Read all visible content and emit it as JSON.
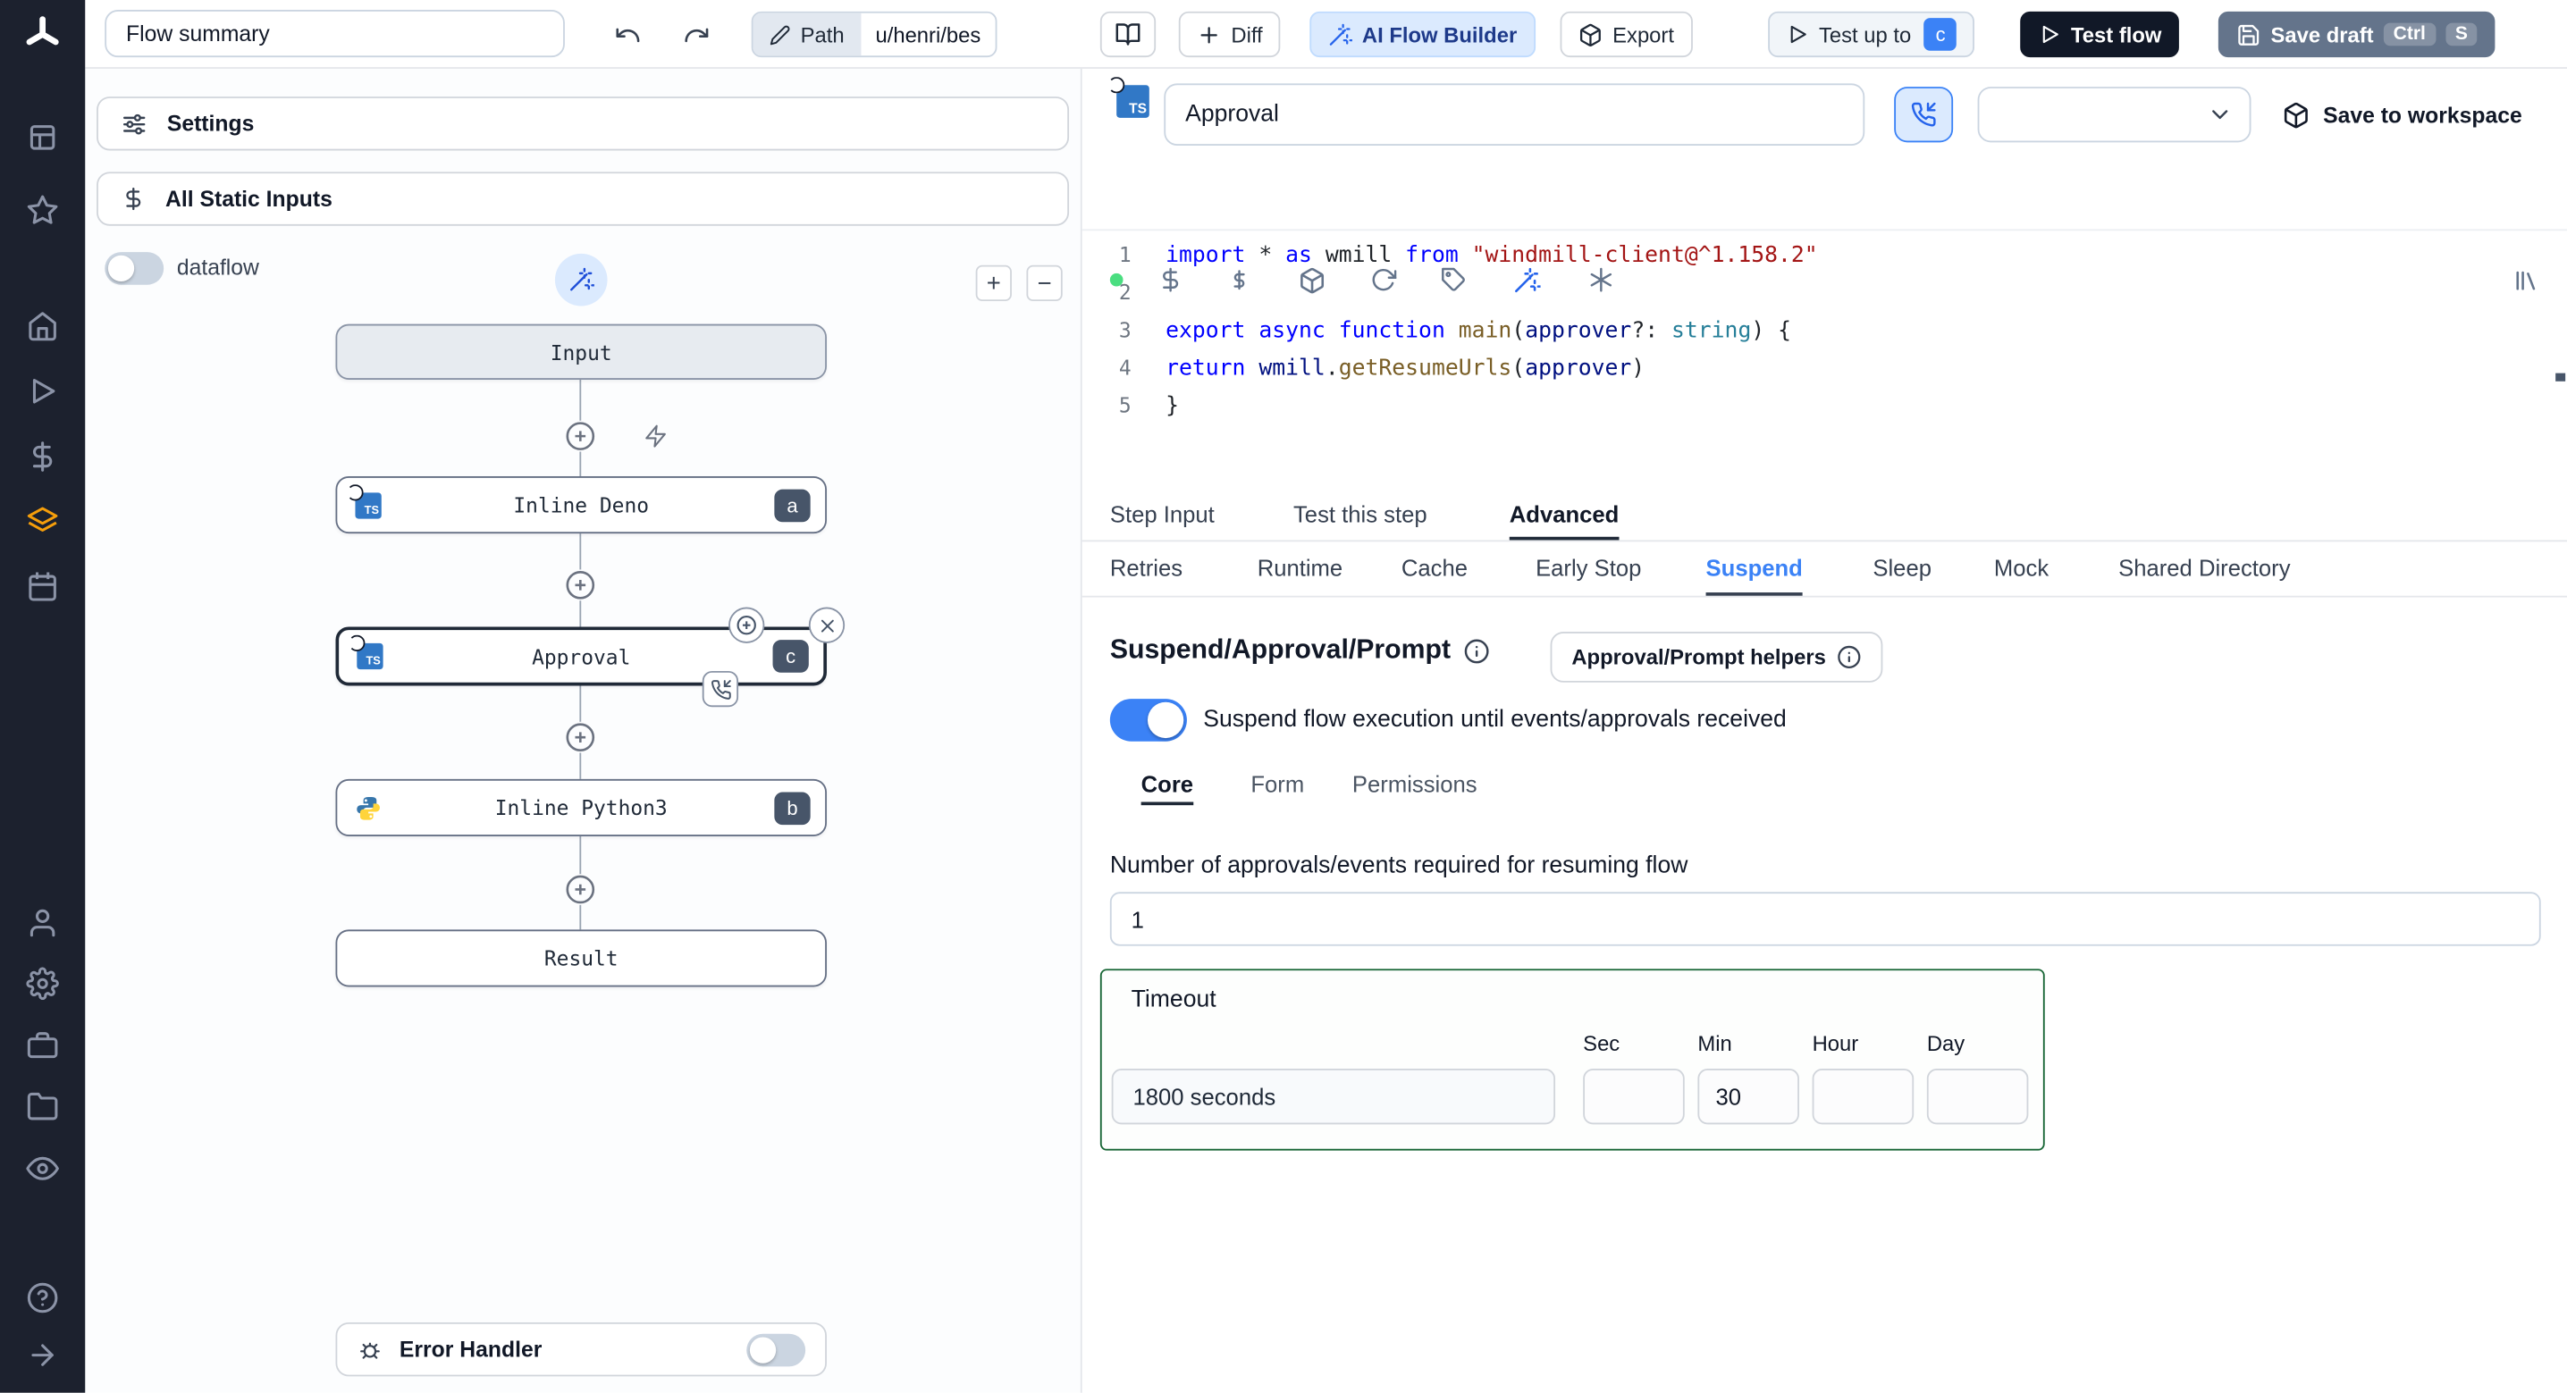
{
  "topbar": {
    "flow_summary_value": "Flow summary",
    "path_label": "Path",
    "path_value": "u/henri/bes",
    "diff_label": "Diff",
    "ai_flow_builder_label": "AI Flow Builder",
    "export_label": "Export",
    "test_up_to_label": "Test up to",
    "test_up_to_badge": "c",
    "test_flow_label": "Test flow",
    "save_draft_label": "Save draft",
    "save_draft_shortcut": [
      "Ctrl",
      "S"
    ]
  },
  "sidebar": {
    "icons": [
      "windmill-logo",
      "apps",
      "favorites",
      "home",
      "runs",
      "variables",
      "resources",
      "schedules",
      "users",
      "settings",
      "workers",
      "folders",
      "audit-logs",
      "help",
      "expand"
    ]
  },
  "flow_panel": {
    "settings_label": "Settings",
    "all_static_inputs_label": "All Static Inputs",
    "dataflow_label": "dataflow",
    "zoom_in_label": "+",
    "zoom_out_label": "−",
    "nodes": {
      "input": {
        "label": "Input"
      },
      "deno": {
        "label": "Inline Deno",
        "badge": "a"
      },
      "approval": {
        "label": "Approval",
        "badge": "c"
      },
      "python": {
        "label": "Inline Python3",
        "badge": "b"
      },
      "result": {
        "label": "Result"
      }
    },
    "error_handler_label": "Error Handler"
  },
  "step": {
    "name_value": "Approval",
    "save_to_workspace_label": "Save to workspace",
    "editor_toolbar_icons": [
      "status-dot",
      "variable-picker",
      "resource-picker",
      "package",
      "reset",
      "tag",
      "ai-assistant",
      "format",
      "library"
    ]
  },
  "code": {
    "lines": [
      {
        "no": "1",
        "segs": [
          [
            "kw",
            "import"
          ],
          [
            "pl",
            " * "
          ],
          [
            "kw",
            "as"
          ],
          [
            "pl",
            " wmill "
          ],
          [
            "kw",
            "from"
          ],
          [
            "pl",
            " "
          ],
          [
            "str",
            "\"windmill-client@^1.158.2\""
          ]
        ]
      },
      {
        "no": "2",
        "segs": []
      },
      {
        "no": "3",
        "segs": [
          [
            "kw",
            "export"
          ],
          [
            "pl",
            " "
          ],
          [
            "kw",
            "async"
          ],
          [
            "pl",
            " "
          ],
          [
            "kw",
            "function"
          ],
          [
            "pl",
            " "
          ],
          [
            "fn",
            "main"
          ],
          [
            "pl",
            "("
          ],
          [
            "var",
            "approver"
          ],
          [
            "pl",
            "?: "
          ],
          [
            "type",
            "string"
          ],
          [
            "pl",
            ") {"
          ]
        ]
      },
      {
        "no": "4",
        "segs": [
          [
            "pl",
            "  "
          ],
          [
            "kw",
            "return"
          ],
          [
            "pl",
            " "
          ],
          [
            "var",
            "wmill"
          ],
          [
            "pl",
            "."
          ],
          [
            "fn",
            "getResumeUrls"
          ],
          [
            "pl",
            "("
          ],
          [
            "var",
            "approver"
          ],
          [
            "pl",
            ")"
          ]
        ]
      },
      {
        "no": "5",
        "segs": [
          [
            "pl",
            "}"
          ]
        ]
      }
    ]
  },
  "tabs_step": [
    {
      "label": "Step Input"
    },
    {
      "label": "Test this step"
    },
    {
      "label": "Advanced",
      "active": true
    }
  ],
  "tabs_advanced": [
    {
      "label": "Retries"
    },
    {
      "label": "Runtime"
    },
    {
      "label": "Cache"
    },
    {
      "label": "Early Stop"
    },
    {
      "label": "Suspend",
      "active": true
    },
    {
      "label": "Sleep"
    },
    {
      "label": "Mock"
    },
    {
      "label": "Shared Directory"
    }
  ],
  "suspend": {
    "title": "Suspend/Approval/Prompt",
    "helpers_button_label": "Approval/Prompt helpers",
    "toggle_label": "Suspend flow execution until events/approvals received",
    "tabs": [
      {
        "label": "Core",
        "active": true
      },
      {
        "label": "Form"
      },
      {
        "label": "Permissions"
      }
    ],
    "approvals_label": "Number of approvals/events required for resuming flow",
    "approvals_value": "1",
    "timeout": {
      "label": "Timeout",
      "readout": "1800 seconds",
      "units": [
        {
          "label": "Sec",
          "value": ""
        },
        {
          "label": "Min",
          "value": "30"
        },
        {
          "label": "Hour",
          "value": ""
        },
        {
          "label": "Day",
          "value": ""
        }
      ]
    }
  },
  "colors": {
    "accent": "#3b82f6",
    "dark_button": "#111827",
    "save_draft_button": "#64748b",
    "timeout_border": "#166534",
    "ts_icon": "#3178c6",
    "status_dot": "#4ade80",
    "resources_icon_orange": "#f59e0b"
  }
}
